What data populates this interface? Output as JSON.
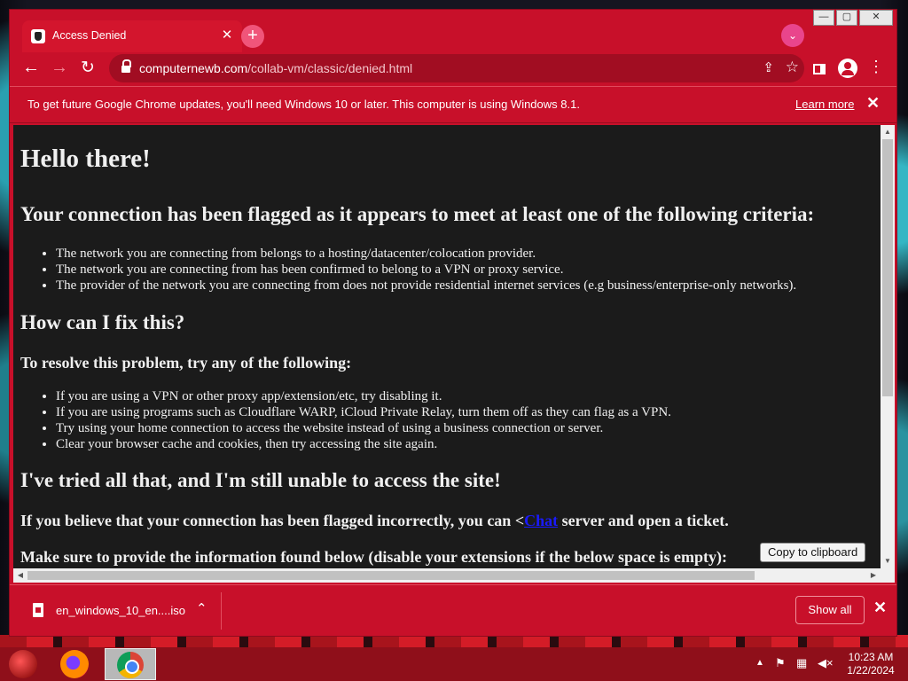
{
  "browser": {
    "tab": {
      "title": "Access Denied",
      "close_glyph": "✕"
    },
    "new_tab_glyph": "+",
    "tab_search_glyph": "⌄",
    "window_controls": {
      "minimize": "—",
      "maximize": "▢",
      "close": "✕"
    },
    "nav": {
      "back": "←",
      "forward": "→",
      "reload": "↻"
    },
    "url": {
      "host": "computernewb.com",
      "path": "/collab-vm/classic/denied.html"
    },
    "actions": {
      "share": "⇪",
      "bookmark": "☆",
      "menu": "⋮"
    }
  },
  "infobar": {
    "message": "To get future Google Chrome updates, you'll need Windows 10 or later. This computer is using Windows 8.1.",
    "link": "Learn more",
    "close_glyph": "✕"
  },
  "page": {
    "heading": "Hello there!",
    "criteria_heading": "Your connection has been flagged as it appears to meet at least one of the following criteria:",
    "criteria": [
      "The network you are connecting from belongs to a hosting/datacenter/colocation provider.",
      "The network you are connecting from has been confirmed to belong to a VPN or proxy service.",
      "The provider of the network you are connecting from does not provide residential internet services (e.g business/enterprise-only networks)."
    ],
    "fix_heading": "How can I fix this?",
    "resolve_heading": "To resolve this problem, try any of the following:",
    "resolve_steps": [
      "If you are using a VPN or other proxy app/extension/etc, try disabling it.",
      "If you are using programs such as Cloudflare WARP, iCloud Private Relay, turn them off as they can flag as a VPN.",
      "Try using your home connection to access the website instead of using a business connection or server.",
      "Clear your browser cache and cookies, then try accessing the site again."
    ],
    "tried_heading": "I've tried all that, and I'm still unable to access the site!",
    "ticket_text_before": "If you believe that your connection has been flagged incorrectly, you can <",
    "ticket_link": "Chat",
    "ticket_text_after": " server and open a ticket.",
    "info_text": "Make sure to provide the information found below (disable your extensions if the below space is empty):",
    "copy_button": "Copy to clipboard"
  },
  "downloads": {
    "file_name": "en_windows_10_en....iso",
    "chevron": "⌃",
    "show_all": "Show all",
    "close_glyph": "✕"
  },
  "taskbar": {
    "time": "10:23 AM",
    "date": "1/22/2024",
    "tray_up": "▲",
    "tray_flag": "⚑",
    "tray_network": "▦",
    "tray_volume": "◀×"
  }
}
